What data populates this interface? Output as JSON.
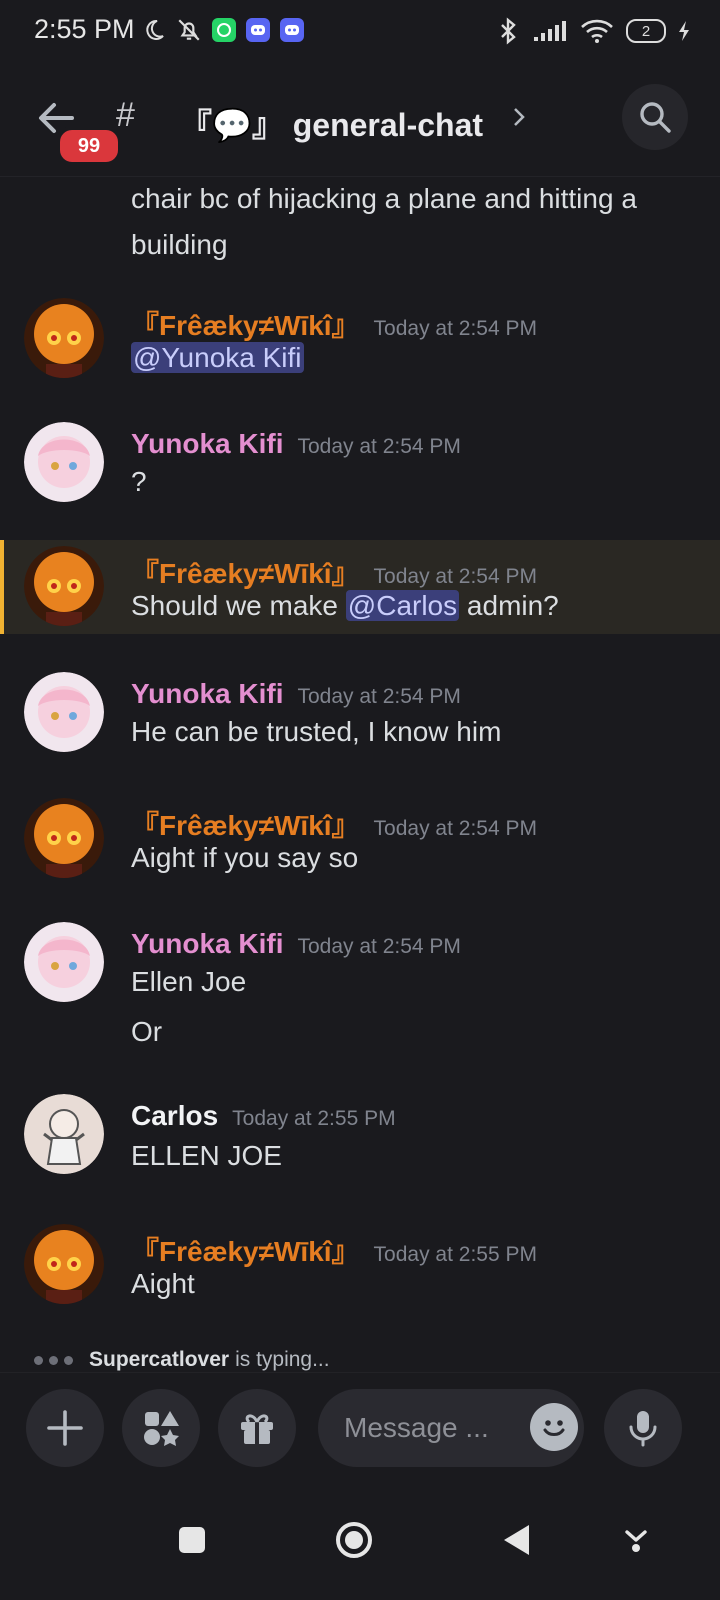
{
  "status_bar": {
    "time": "2:55 PM",
    "battery": "2"
  },
  "header": {
    "unread_count": "99",
    "channel_prefix": "#",
    "channel_name": "『💬』 general-chat"
  },
  "continuation": {
    "text": "chair bc of hijacking a plane and hitting a building"
  },
  "users": {
    "freaky": {
      "name": "『Frêæky≠Wīkî』",
      "color": "#e67e22"
    },
    "yunoka": {
      "name": "Yunoka Kifi",
      "color": "#e48fd0"
    },
    "carlos": {
      "name": "Carlos",
      "color": "#f2f3f5"
    }
  },
  "messages": [
    {
      "author": "『Frêæky≠Wīkî』",
      "time": "Today at 2:54 PM",
      "mention": "@Yunoka Kifi"
    },
    {
      "author": "Yunoka Kifi",
      "time": "Today at 2:54 PM",
      "text": "?"
    },
    {
      "author": "『Frêæky≠Wīkî』",
      "time": "Today at 2:54 PM",
      "text_before": "Should we make ",
      "mention": "@Carlos",
      "text_after": " admin?"
    },
    {
      "author": "Yunoka Kifi",
      "time": "Today at 2:54 PM",
      "text": "He can be trusted, I know him"
    },
    {
      "author": "『Frêæky≠Wīkî』",
      "time": "Today at 2:54 PM",
      "text": "Aight if you say so"
    },
    {
      "author": "Yunoka Kifi",
      "time": "Today at 2:54 PM",
      "lines": [
        "Ellen Joe",
        "Or"
      ]
    },
    {
      "author": "Carlos",
      "time": "Today at 2:55 PM",
      "text": "ELLEN JOE"
    },
    {
      "author": "『Frêæky≠Wīkî』",
      "time": "Today at 2:55 PM",
      "text": "Aight"
    }
  ],
  "typing": {
    "user": "Supercatlover",
    "suffix": "is typing..."
  },
  "composer": {
    "placeholder": "Message ..."
  },
  "icons": {
    "status": [
      "moon-icon",
      "bell-off-icon",
      "whatsapp-icon",
      "discord-icon",
      "discord-icon",
      "bluetooth-icon",
      "signal-icon",
      "wifi-icon",
      "battery-icon",
      "charging-icon"
    ],
    "header": [
      "back-arrow-icon",
      "hash-icon",
      "chevron-right-icon",
      "search-icon"
    ],
    "composer": [
      "plus-icon",
      "apps-icon",
      "gift-icon",
      "emoji-icon",
      "microphone-icon"
    ],
    "nav": [
      "square-icon",
      "circle-icon",
      "triangle-back-icon",
      "keyboard-hide-icon"
    ]
  }
}
